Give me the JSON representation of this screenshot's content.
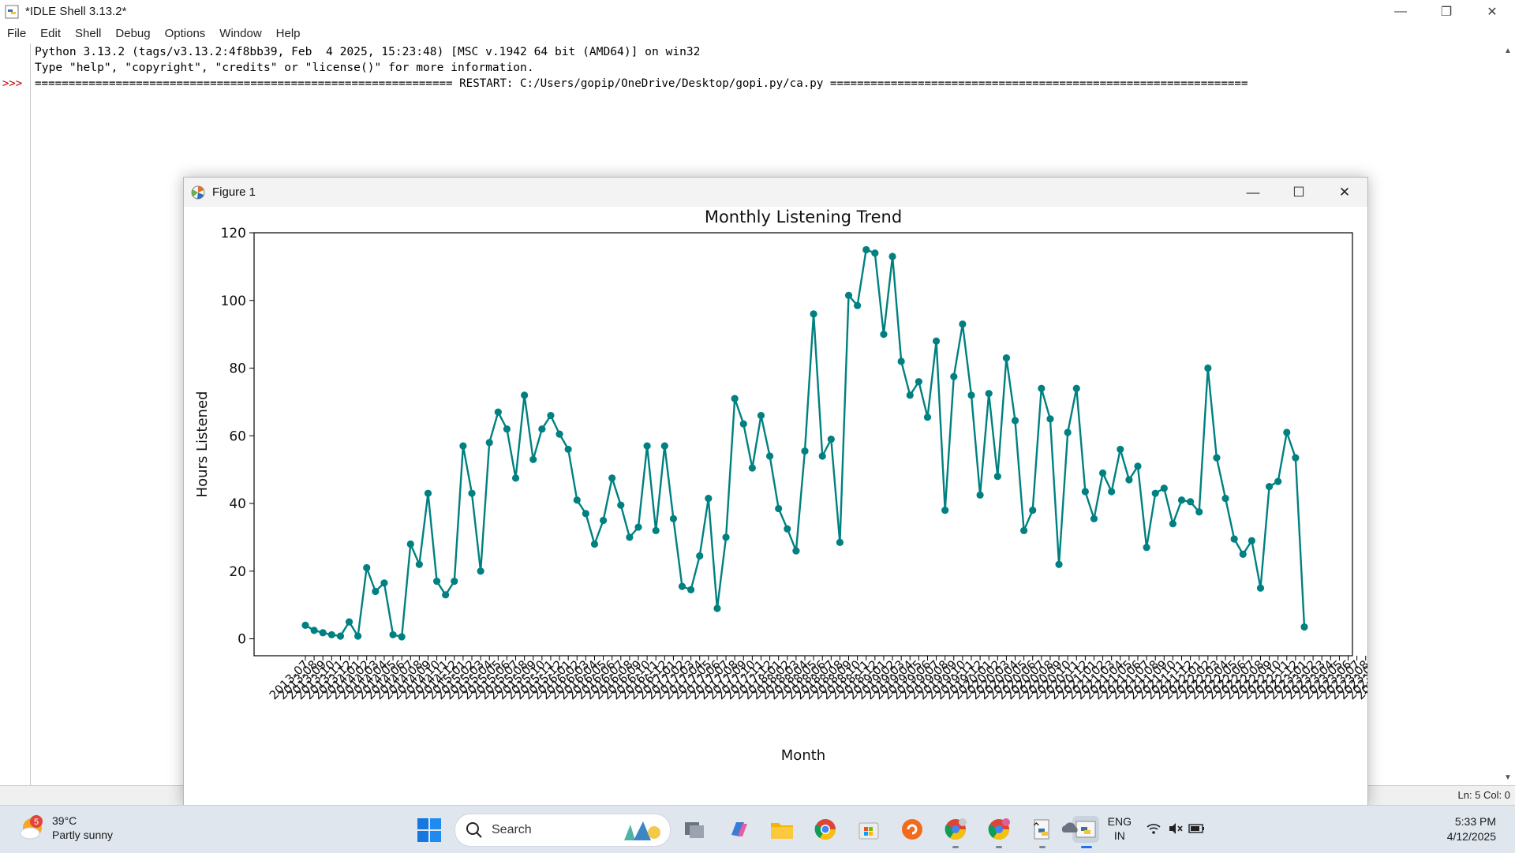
{
  "idle": {
    "title": "*IDLE Shell 3.13.2*",
    "menu": [
      "File",
      "Edit",
      "Shell",
      "Debug",
      "Options",
      "Window",
      "Help"
    ],
    "prompt": ">>>",
    "lines": [
      "Python 3.13.2 (tags/v3.13.2:4f8bb39, Feb  4 2025, 15:23:48) [MSC v.1942 64 bit (AMD64)] on win32",
      "Type \"help\", \"copyright\", \"credits\" or \"license()\" for more information.",
      "",
      "============================================================== RESTART: C:/Users/gopip/OneDrive/Desktop/gopi.py/ca.py =============================================================="
    ],
    "status": "Ln: 5   Col: 0"
  },
  "figure": {
    "title": "Figure 1"
  },
  "chart_data": {
    "type": "line",
    "title": "Monthly Listening Trend",
    "xlabel": "Month",
    "ylabel": "Hours Listened",
    "ylim": [
      -5,
      120
    ],
    "yticks": [
      0,
      20,
      40,
      60,
      80,
      100,
      120
    ],
    "line_color": "#008080",
    "grid": false,
    "categories": [
      "2013-07",
      "2013-08",
      "2013-09",
      "2013-10",
      "2013-11",
      "2013-12",
      "2014-01",
      "2014-02",
      "2014-03",
      "2014-04",
      "2014-05",
      "2014-06",
      "2014-07",
      "2014-08",
      "2014-09",
      "2014-10",
      "2014-11",
      "2014-12",
      "2015-01",
      "2015-02",
      "2015-03",
      "2015-04",
      "2015-05",
      "2015-06",
      "2015-07",
      "2015-08",
      "2015-09",
      "2015-10",
      "2015-11",
      "2015-12",
      "2016-01",
      "2016-02",
      "2016-03",
      "2016-04",
      "2016-05",
      "2016-06",
      "2016-07",
      "2016-08",
      "2016-09",
      "2016-10",
      "2016-11",
      "2016-12",
      "2017-01",
      "2017-02",
      "2017-03",
      "2017-04",
      "2017-05",
      "2017-06",
      "2017-07",
      "2017-08",
      "2017-09",
      "2017-10",
      "2017-11",
      "2017-12",
      "2018-01",
      "2018-02",
      "2018-03",
      "2018-04",
      "2018-05",
      "2018-06",
      "2018-07",
      "2018-08",
      "2018-09",
      "2018-10",
      "2018-11",
      "2018-12",
      "2019-01",
      "2019-02",
      "2019-03",
      "2019-04",
      "2019-05",
      "2019-06",
      "2019-07",
      "2019-08",
      "2019-09",
      "2019-10",
      "2019-11",
      "2019-12",
      "2020-01",
      "2020-02",
      "2020-03",
      "2020-04",
      "2020-05",
      "2020-06",
      "2020-07",
      "2020-08",
      "2020-09",
      "2020-10",
      "2020-11",
      "2020-12",
      "2021-01",
      "2021-02",
      "2021-03",
      "2021-04",
      "2021-05",
      "2021-06",
      "2021-07",
      "2021-08",
      "2021-09",
      "2021-10",
      "2021-11",
      "2021-12",
      "2022-01",
      "2022-02",
      "2022-03",
      "2022-04",
      "2022-05",
      "2022-06",
      "2022-07",
      "2022-08",
      "2022-09",
      "2022-10",
      "2022-11",
      "2022-12",
      "2023-01",
      "2023-02",
      "2023-03",
      "2023-04",
      "2023-05",
      "2023-06",
      "2023-07",
      "2023-08",
      "2023-09",
      "2023-10",
      "2023-11",
      "2023-12",
      "2024-01",
      "2024-02",
      "2024-03",
      "2024-04",
      "2024-05",
      "2024-06",
      "2024-07",
      "2024-08",
      "2024-09",
      "2024-10",
      "2024-11",
      "2024-12"
    ],
    "values": [
      4,
      2.5,
      1.8,
      1.2,
      0.8,
      5,
      0.8,
      21,
      14,
      16.5,
      1.2,
      0.6,
      28,
      22,
      43,
      17,
      13,
      17,
      57,
      43,
      20,
      58,
      67,
      62,
      47.5,
      72,
      53,
      62,
      66,
      60.5,
      56,
      41,
      37,
      28,
      35,
      47.5,
      39.5,
      30,
      33,
      57,
      32,
      57,
      35.5,
      15.5,
      14.5,
      24.5,
      41.5,
      9,
      30,
      71,
      63.5,
      50.5,
      66,
      54,
      38.5,
      32.5,
      26,
      55.5,
      96,
      54,
      59,
      28.5,
      101.5,
      98.5,
      115,
      114,
      90,
      113,
      82,
      72,
      76,
      65.5,
      88,
      38,
      77.5,
      93,
      72,
      42.5,
      72.5,
      48,
      83,
      64.5,
      32,
      38,
      74,
      65,
      22,
      61,
      74,
      43.5,
      35.5,
      49,
      43.5,
      56,
      47,
      51,
      27,
      43,
      44.5,
      34,
      41,
      40.5,
      37.5,
      80,
      53.5,
      41.5,
      29.5,
      25,
      29,
      15,
      45,
      46.5,
      61,
      53.5,
      3.5
    ]
  },
  "taskbar": {
    "weather_badge": "5",
    "temperature": "39°C",
    "weather_desc": "Partly sunny",
    "search_label": "Search",
    "lang_top": "ENG",
    "lang_bottom": "IN",
    "time": "5:33 PM",
    "date": "4/12/2025"
  }
}
